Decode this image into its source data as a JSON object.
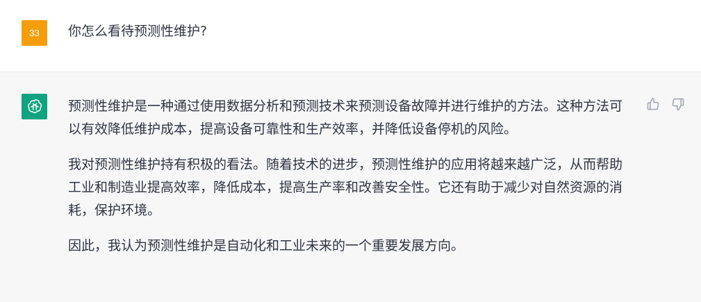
{
  "conversation": {
    "user_message": {
      "avatar_text": "33",
      "text": "你怎么看待预测性维护?"
    },
    "assistant_message": {
      "paragraphs": [
        "预测性维护是一种通过使用数据分析和预测技术来预测设备故障并进行维护的方法。这种方法可以有效降低维护成本，提高设备可靠性和生产效率，并降低设备停机的风险。",
        "我对预测性维护持有积极的看法。随着技术的进步，预测性维护的应用将越来越广泛，从而帮助工业和制造业提高效率，降低成本，提高生产率和改善安全性。它还有助于减少对自然资源的消耗，保护环境。",
        "因此，我认为预测性维护是自动化和工业未来的一个重要发展方向。"
      ],
      "actions": {
        "thumbs_up_icon": "thumbs-up-icon",
        "thumbs_down_icon": "thumbs-down-icon"
      }
    }
  },
  "colors": {
    "user_avatar_bg": "#f59e0b",
    "assistant_avatar_bg": "#10a37f",
    "assistant_row_bg": "#f7f7f8",
    "text": "#2f3542"
  }
}
